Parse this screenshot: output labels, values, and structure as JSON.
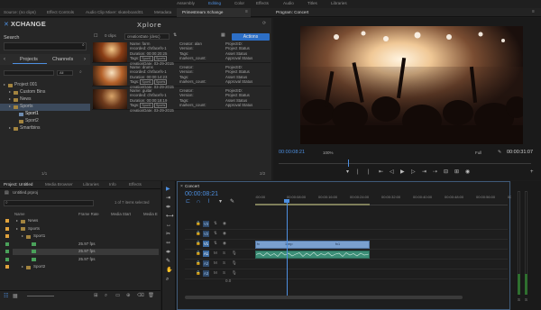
{
  "workspace": {
    "items": [
      "Assembly",
      "Editing",
      "Color",
      "Effects",
      "Audio",
      "Titles",
      "Libraries"
    ],
    "active": "Editing"
  },
  "panel_tabs": {
    "source": "Source: (no clips)",
    "effect_controls": "Effect Controls",
    "audio_mixer": "Audio Clip Mixer: skateboard01",
    "metadata": "Metadata",
    "xchange": "Primestream Xchange",
    "program": "Program: Concert"
  },
  "xchange": {
    "logo": "XCHANGE",
    "title": "Xplore",
    "search_label": "Search",
    "nav": [
      "Projects",
      "Channels"
    ],
    "filter_all": "All",
    "tree": [
      {
        "label": "Project 001",
        "level": 1
      },
      {
        "label": "Custom Bins",
        "level": 2
      },
      {
        "label": "News",
        "level": 2
      },
      {
        "label": "Sports",
        "level": 2
      },
      {
        "label": "Sport1",
        "level": 3,
        "selected": true
      },
      {
        "label": "Sport2",
        "level": 3
      },
      {
        "label": "Smartbins",
        "level": 2
      }
    ],
    "left_footer": "1/1",
    "mid_footer": "2/2",
    "clip_count": "0 clips",
    "sort": "creationDate (desc)",
    "actions": "Actions",
    "assets": [
      {
        "left": [
          "Name: farm",
          "recorded: chrfacefs-1",
          "Duration: 00:00:20:25",
          "Tags:",
          "creationDate: 03-29-2015"
        ],
        "tags": [
          "Sport1",
          "Sports"
        ],
        "right": [
          "Creator: alan",
          "Version:",
          "Tags:",
          "markers_count:"
        ],
        "far": [
          "ProjectID:",
          "Project Status",
          "Asset Status",
          "Approval Status"
        ]
      },
      {
        "left": [
          "Name: drums",
          "recorded: chrfacefs-1",
          "Duration: 00:00:14:23",
          "Tags:",
          "creationDate: 03-29-2015"
        ],
        "tags": [
          "Sport1",
          "Sports"
        ],
        "right": [
          "Creator:",
          "Version:",
          "Tags:",
          "markers_count:"
        ],
        "far": [
          "ProjectID:",
          "Project Status",
          "Asset Status",
          "Approval Status"
        ]
      },
      {
        "left": [
          "Name: guitar",
          "recorded: chrfacefs-1",
          "Duration: 00:00:18:19",
          "Tags:",
          "creationDate: 03-29-2015"
        ],
        "tags": [
          "Sport1",
          "Sports"
        ],
        "right": [
          "Creator:",
          "Version:",
          "Tags:",
          "markers_count:"
        ],
        "far": [
          "ProjectID:",
          "Project Status",
          "Asset Status",
          "Approval Status"
        ]
      }
    ]
  },
  "program": {
    "timecode": "00:00:08:21",
    "zoom": "100%",
    "quality": "Full",
    "duration": "00:00:31:07",
    "controls": [
      "▾",
      "|",
      "|",
      "⇤",
      "◁",
      "▶",
      "▷",
      "⇥",
      "⇢",
      "⊟",
      "⊞",
      "◉"
    ]
  },
  "project": {
    "tabs": [
      "Project: Untitled",
      "Media Browser",
      "Libraries",
      "Info",
      "Effects"
    ],
    "active_tab": "Project: Untitled",
    "file": "Untitled.prproj",
    "selected": "1 of 7 items selected",
    "columns": [
      "Name",
      "Frame Rate",
      "Media Start",
      "Media E"
    ],
    "rows": [
      {
        "name": "News",
        "fps": "",
        "type": "bin",
        "color": "#e0a23c"
      },
      {
        "name": "Sports",
        "fps": "",
        "type": "bin",
        "color": "#e0a23c"
      },
      {
        "name": "Sport1",
        "fps": "",
        "type": "bin",
        "color": "#e0a23c"
      },
      {
        "name": "",
        "fps": "25.97 fps",
        "type": "clip",
        "color": "#4aa15a"
      },
      {
        "name": "",
        "fps": "25.97 fps",
        "type": "clip",
        "color": "#4aa15a"
      },
      {
        "name": "",
        "fps": "25.97 fps",
        "type": "clip",
        "color": "#4aa15a"
      },
      {
        "name": "Sport2",
        "fps": "",
        "type": "bin",
        "color": "#e0a23c"
      }
    ]
  },
  "timeline": {
    "timecode": "00:00:08:21",
    "ruler": [
      ":00:00",
      "00:00:08:00",
      "00:00:16:00",
      "00:00:24:00",
      "00:00:32:00",
      "00:00:40:00",
      "00:00:48:00",
      "00:00:56:00",
      "00:01:04:00"
    ],
    "tracks": [
      "V3",
      "V2",
      "V1",
      "A1",
      "A2",
      "A3"
    ],
    "clip_video_a": "1 mp",
    "clip_video_b": "fx1",
    "master": "0.0"
  },
  "meters": {
    "levels": [
      0.2,
      0.2
    ]
  }
}
